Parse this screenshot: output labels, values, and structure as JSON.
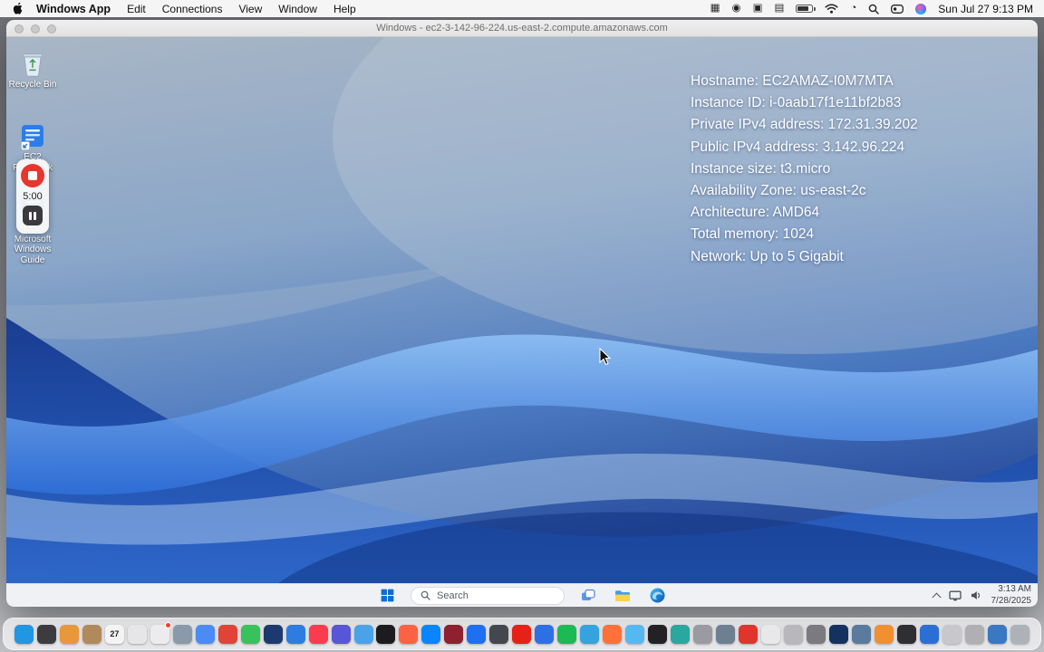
{
  "menu_bar": {
    "app_name": "Windows App",
    "menus": [
      "Edit",
      "Connections",
      "View",
      "Window",
      "Help"
    ],
    "status_icons": [
      {
        "name": "apps-grid-icon",
        "kind": "glyph",
        "glyph": "▦"
      },
      {
        "name": "screen-record-icon",
        "kind": "glyph",
        "glyph": "◉"
      },
      {
        "name": "display-icon",
        "kind": "glyph",
        "glyph": "▣"
      },
      {
        "name": "keyboard-icon",
        "kind": "glyph",
        "glyph": "▤"
      },
      {
        "name": "battery-icon",
        "kind": "battery"
      },
      {
        "name": "wifi-icon",
        "kind": "wifi"
      },
      {
        "name": "clock-icon",
        "kind": "glyph",
        "glyph": "◔"
      },
      {
        "name": "spotlight-search-icon",
        "kind": "search"
      },
      {
        "name": "control-center-icon",
        "kind": "cc"
      },
      {
        "name": "siri-icon",
        "kind": "siri"
      }
    ],
    "clock": "Sun Jul 27 9:13 PM"
  },
  "window": {
    "title": "Windows - ec2-3-142-96-224.us-east-2.compute.amazonaws.com"
  },
  "remote_desktop": {
    "system_info": [
      "Hostname: EC2AMAZ-I0M7MTA",
      "Instance ID: i-0aab17f1e11bf2b83",
      "Private IPv4 address: 172.31.39.202",
      "Public IPv4 address: 3.142.96.224",
      "Instance size: t3.micro",
      "Availability Zone: us-east-2c",
      "Architecture: AMD64",
      "Total memory: 1024",
      "Network: Up to 5 Gigabit"
    ],
    "desktop_icons": [
      {
        "label": "Recycle Bin"
      },
      {
        "label": "EC2 Feedback"
      },
      {
        "label": "EC2 Microsoft Windows Guide"
      }
    ],
    "recording_widget": {
      "elapsed": "5:00"
    },
    "taskbar": {
      "search_placeholder": "Search",
      "time": "3:13 AM",
      "date": "7/28/2025"
    }
  },
  "dock": {
    "items": [
      {
        "name": "finder",
        "color": "#2196e3"
      },
      {
        "name": "app",
        "color": "#3c3c40"
      },
      {
        "name": "launchpad",
        "color": "#e8973a"
      },
      {
        "name": "app",
        "color": "#b08a5c"
      },
      {
        "name": "calendar",
        "color": "#f4f4f4",
        "label": "27"
      },
      {
        "name": "notes",
        "color": "#e6e6e8"
      },
      {
        "name": "mail",
        "color": "#ececee",
        "badge": true
      },
      {
        "name": "app",
        "color": "#8a9aaa"
      },
      {
        "name": "chrome",
        "color": "#4c8bf5"
      },
      {
        "name": "app",
        "color": "#e04438"
      },
      {
        "name": "app",
        "color": "#38c25c"
      },
      {
        "name": "app",
        "color": "#1d3a6e"
      },
      {
        "name": "app",
        "color": "#2d7de0"
      },
      {
        "name": "music",
        "color": "#fa3c4e"
      },
      {
        "name": "app",
        "color": "#5856d6"
      },
      {
        "name": "app",
        "color": "#4aa3e8"
      },
      {
        "name": "tv",
        "color": "#1c1c1e"
      },
      {
        "name": "app",
        "color": "#ff6242"
      },
      {
        "name": "app",
        "color": "#0a84ff"
      },
      {
        "name": "app",
        "color": "#8e2030"
      },
      {
        "name": "app-store",
        "color": "#1f6ff2"
      },
      {
        "name": "app",
        "color": "#44484e"
      },
      {
        "name": "youtube",
        "color": "#e62117"
      },
      {
        "name": "app",
        "color": "#2f6fe4"
      },
      {
        "name": "spotify",
        "color": "#1db954"
      },
      {
        "name": "edge",
        "color": "#35a3dd"
      },
      {
        "name": "firefox",
        "color": "#ff7139"
      },
      {
        "name": "app",
        "color": "#54b9f0"
      },
      {
        "name": "app",
        "color": "#222226"
      },
      {
        "name": "app",
        "color": "#2aa8a0"
      },
      {
        "name": "app",
        "color": "#9a9aa0"
      },
      {
        "name": "app",
        "color": "#6e7f92"
      },
      {
        "name": "app",
        "color": "#e0352c"
      },
      {
        "name": "app",
        "color": "#e8e8ea"
      },
      {
        "name": "app",
        "color": "#b8b8bc"
      },
      {
        "name": "settings",
        "color": "#7a7a80"
      },
      {
        "name": "app",
        "color": "#14325f"
      },
      {
        "name": "app",
        "color": "#5a7a9e"
      },
      {
        "name": "app",
        "color": "#f09030"
      },
      {
        "name": "terminal",
        "color": "#2f2f33"
      },
      {
        "name": "app",
        "color": "#2b6fd4"
      },
      {
        "name": "app",
        "color": "#c8c8cc"
      },
      {
        "name": "app",
        "color": "#b0b0b4"
      },
      {
        "name": "app",
        "color": "#3a78c2"
      },
      {
        "name": "trash",
        "color": "#aeb2b8"
      }
    ]
  }
}
